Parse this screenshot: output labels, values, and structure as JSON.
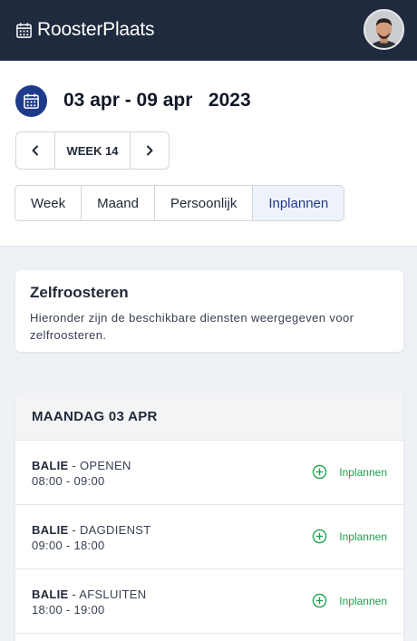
{
  "topbar": {
    "brand": "RoosterPlaats",
    "icon": "calendar-icon",
    "avatar": "user-avatar"
  },
  "header": {
    "date_range": "03 apr - 09 apr   2023",
    "week_label": "WEEK 14",
    "prev_icon": "chevron-left-icon",
    "next_icon": "chevron-right-icon",
    "tabs": [
      {
        "label": "Week",
        "active": false
      },
      {
        "label": "Maand",
        "active": false
      },
      {
        "label": "Persoonlijk",
        "active": false
      },
      {
        "label": "Inplannen",
        "active": true
      }
    ]
  },
  "intro": {
    "title": "Zelfroosteren",
    "text": "Hieronder zijn de beschikbare diensten weergegeven voor zelfroosteren."
  },
  "day": {
    "title": "MAANDAG 03 APR",
    "shifts": [
      {
        "location": "BALIE",
        "separator": " - ",
        "name": "OPENEN",
        "time": "08:00 - 09:00",
        "action": "Inplannen"
      },
      {
        "location": "BALIE",
        "separator": " - ",
        "name": "DAGDIENST",
        "time": "09:00 - 18:00",
        "action": "Inplannen"
      },
      {
        "location": "BALIE",
        "separator": " - ",
        "name": "AFSLUITEN",
        "time": "18:00 - 19:00",
        "action": "Inplannen"
      }
    ]
  },
  "colors": {
    "topbar": "#1f2a3e",
    "accent": "#1e3a8a",
    "action": "#16a34a"
  }
}
